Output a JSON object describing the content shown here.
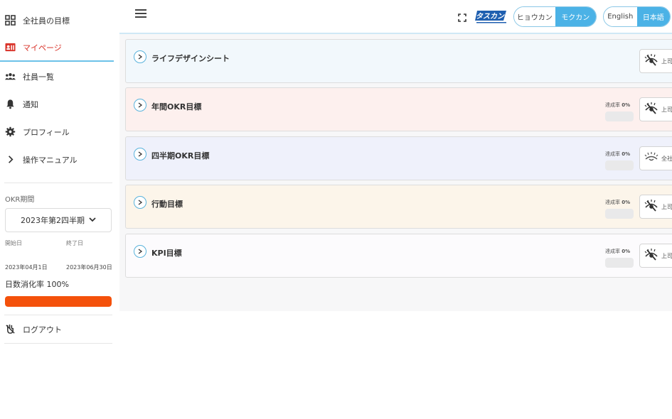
{
  "sidebar": {
    "items": [
      {
        "label": "全社員の目標",
        "icon": "grid-icon"
      },
      {
        "label": "マイページ",
        "icon": "id-card-icon"
      },
      {
        "label": "社員一覧",
        "icon": "people-icon"
      },
      {
        "label": "通知",
        "icon": "bell-icon"
      },
      {
        "label": "プロフィール",
        "icon": "gear-icon"
      },
      {
        "label": "操作マニュアル",
        "icon": "chevron-right-icon"
      }
    ],
    "okr_period_label": "OKR期間",
    "period_value": "2023年第2四半期",
    "start_label": "開始日",
    "end_label": "終了日",
    "start_date": "2023年04月1日",
    "end_date": "2023年06月30日",
    "progress_text": "日数消化率 100%",
    "progress_fraction": 1.0,
    "progress_color": "#f4510b",
    "logout_label": "ログアウト"
  },
  "header": {
    "logo_text": "タスカン",
    "mode_options": [
      "ヒョウカン",
      "モクカン"
    ],
    "mode_selected": "モクカン",
    "lang_options": [
      "English",
      "日本語"
    ],
    "lang_selected": "日本語",
    "accent_color": "#4bb2e6"
  },
  "cards": [
    {
      "title": "ライフデザインシート",
      "bg": "#f2f8fc",
      "show_rate": false,
      "rate_label": "",
      "rate_value": "",
      "button_text": "上司",
      "button_icon": "eye-off-icon"
    },
    {
      "title": "年間OKR目標",
      "bg": "#fdf0ee",
      "show_rate": true,
      "rate_label": "達成率",
      "rate_value": "0%",
      "button_text": "上司",
      "button_icon": "eye-off-icon"
    },
    {
      "title": "四半期OKR目標",
      "bg": "#eff1fb",
      "show_rate": true,
      "rate_label": "達成率",
      "rate_value": "0%",
      "button_text": "全社",
      "button_icon": "eye-icon"
    },
    {
      "title": "行動目標",
      "bg": "#fcf5ea",
      "show_rate": true,
      "rate_label": "達成率",
      "rate_value": "0%",
      "button_text": "上司",
      "button_icon": "eye-off-icon"
    },
    {
      "title": "KPI目標",
      "bg": "#fcfbfd",
      "show_rate": true,
      "rate_label": "達成率",
      "rate_value": "0%",
      "button_text": "上司",
      "button_icon": "eye-off-icon"
    }
  ]
}
